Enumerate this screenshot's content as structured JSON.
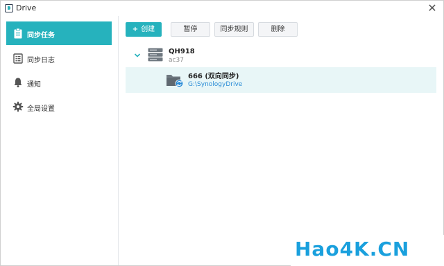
{
  "window": {
    "title": "Drive",
    "close_glyph": "✕"
  },
  "sidebar": {
    "items": [
      {
        "label": "同步任务",
        "icon": "clipboard-icon",
        "active": true
      },
      {
        "label": "同步日志",
        "icon": "log-list-icon",
        "active": false
      },
      {
        "label": "通知",
        "icon": "bell-icon",
        "active": false
      },
      {
        "label": "全局设置",
        "icon": "gear-icon",
        "active": false
      }
    ]
  },
  "toolbar": {
    "create_icon": "+",
    "create_label": "创建",
    "pause_label": "暂停",
    "rules_label": "同步规则",
    "delete_label": "删除"
  },
  "server": {
    "name": "QH918",
    "subtitle": "ac37",
    "icon": "server-icon",
    "expanded": true
  },
  "task": {
    "name": "666 (双向同步)",
    "path": "G:\\SynologyDrive",
    "icon": "sync-folder-icon"
  },
  "watermark": {
    "text": "Hao4K.CN"
  },
  "colors": {
    "accent": "#26b2bd",
    "link": "#2a8cd6",
    "selected_row": "#e8f6f7",
    "watermark": "#1aa0dd"
  }
}
